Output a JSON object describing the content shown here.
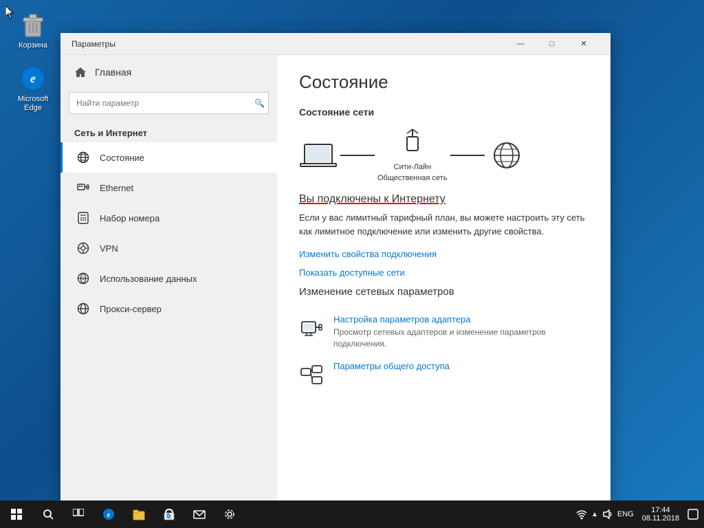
{
  "desktop": {
    "icons": [
      {
        "id": "recycle-bin",
        "label": "Корзина",
        "symbol": "🗑"
      },
      {
        "id": "edge",
        "label": "Microsoft Edge",
        "symbol": "e"
      }
    ]
  },
  "taskbar": {
    "start_label": "Пуск",
    "items": [
      "search",
      "task-view",
      "edge",
      "explorer",
      "store",
      "mail",
      "settings"
    ],
    "time": "17:44",
    "date": "08.11.2018",
    "lang": "ENG"
  },
  "window": {
    "title": "Параметры",
    "controls": {
      "minimize": "—",
      "maximize": "□",
      "close": "✕"
    }
  },
  "sidebar": {
    "home_label": "Главная",
    "search_placeholder": "Найти параметр",
    "section_title": "Сеть и Интернет",
    "items": [
      {
        "id": "status",
        "label": "Состояние",
        "icon": "globe",
        "active": true
      },
      {
        "id": "ethernet",
        "label": "Ethernet",
        "icon": "ethernet"
      },
      {
        "id": "dialup",
        "label": "Набор номера",
        "icon": "phone"
      },
      {
        "id": "vpn",
        "label": "VPN",
        "icon": "vpn"
      },
      {
        "id": "data-usage",
        "label": "Использование данных",
        "icon": "data"
      },
      {
        "id": "proxy",
        "label": "Прокси-сервер",
        "icon": "globe"
      }
    ]
  },
  "main": {
    "page_title": "Состояние",
    "network_status_title": "Состояние сети",
    "network_name": "Сити-Лайн",
    "network_type": "Общественная сеть",
    "connected_text": "Вы подключены к Интернету",
    "info_text": "Если у вас лимитный тарифный план, вы можете настроить эту сеть как лимитное подключение или изменить другие свойства.",
    "link1": "Изменить свойства подключения",
    "link2": "Показать доступные сети",
    "change_section_title": "Изменение сетевых параметров",
    "settings_items": [
      {
        "id": "adapter",
        "icon": "adapter",
        "title": "Настройка параметров адаптера",
        "desc": "Просмотр сетевых адаптеров и изменение параметров подключения."
      },
      {
        "id": "sharing",
        "icon": "sharing",
        "title": "Параметры общего доступа",
        "desc": ""
      }
    ]
  }
}
